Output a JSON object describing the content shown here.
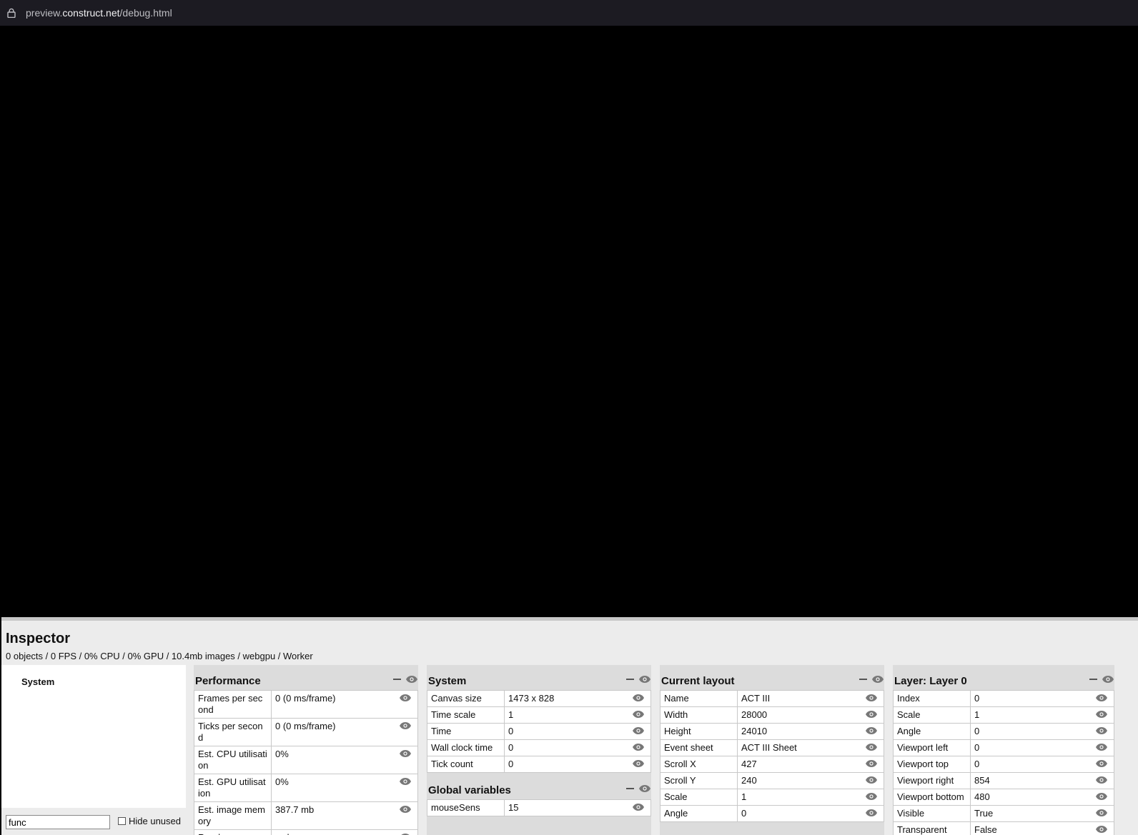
{
  "browser": {
    "url_host_prefix": "preview.",
    "url_host": "construct.net",
    "url_path": "/debug.html"
  },
  "inspector": {
    "title": "Inspector",
    "stats": "0 objects / 0 FPS / 0% CPU / 0% GPU / 10.4mb images / webgpu / Worker",
    "tree": {
      "items": [
        "System"
      ],
      "search_value": "func",
      "hide_unused_label": "Hide unused",
      "hide_unused_checked": false
    },
    "panels": {
      "performance": {
        "title": "Performance",
        "rows": [
          {
            "key": "Frames per second",
            "value": "0 (0 ms/frame)"
          },
          {
            "key": "Ticks per second",
            "value": "0 (0 ms/frame)"
          },
          {
            "key": "Est. CPU utilisation",
            "value": "0%"
          },
          {
            "key": "Est. GPU utilisation",
            "value": "0%"
          },
          {
            "key": "Est. image memory",
            "value": "387.7 mb"
          },
          {
            "key": "Renderer",
            "value": "webgpu"
          }
        ]
      },
      "system": {
        "title": "System",
        "rows": [
          {
            "key": "Canvas size",
            "value": "1473 x 828"
          },
          {
            "key": "Time scale",
            "value": "1"
          },
          {
            "key": "Time",
            "value": "0"
          },
          {
            "key": "Wall clock time",
            "value": "0"
          },
          {
            "key": "Tick count",
            "value": "0"
          }
        ]
      },
      "global_variables": {
        "title": "Global variables",
        "rows": [
          {
            "key": "mouseSens",
            "value": "15"
          }
        ]
      },
      "current_layout": {
        "title": "Current layout",
        "rows": [
          {
            "key": "Name",
            "value": "ACT III"
          },
          {
            "key": "Width",
            "value": "28000"
          },
          {
            "key": "Height",
            "value": "24010"
          },
          {
            "key": "Event sheet",
            "value": "ACT III Sheet"
          },
          {
            "key": "Scroll X",
            "value": "427"
          },
          {
            "key": "Scroll Y",
            "value": "240"
          },
          {
            "key": "Scale",
            "value": "1"
          },
          {
            "key": "Angle",
            "value": "0"
          }
        ]
      },
      "layer": {
        "title": "Layer: Layer 0",
        "rows": [
          {
            "key": "Index",
            "value": "0"
          },
          {
            "key": "Scale",
            "value": "1"
          },
          {
            "key": "Angle",
            "value": "0"
          },
          {
            "key": "Viewport left",
            "value": "0"
          },
          {
            "key": "Viewport top",
            "value": "0"
          },
          {
            "key": "Viewport right",
            "value": "854"
          },
          {
            "key": "Viewport bottom",
            "value": "480"
          },
          {
            "key": "Visible",
            "value": "True"
          },
          {
            "key": "Transparent",
            "value": "False"
          }
        ]
      }
    }
  },
  "icons": {
    "watch": "eye-icon",
    "collapse": "minimize-icon",
    "secure": "lock-icon"
  }
}
